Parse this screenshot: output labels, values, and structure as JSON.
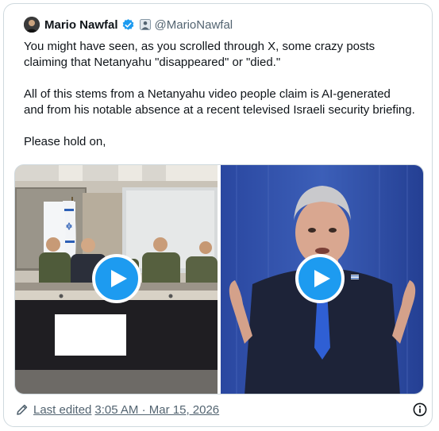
{
  "author": {
    "name": "Mario Nawfal",
    "handle": "@MarioNawfal",
    "verified_color": "#1d9bf0"
  },
  "post": {
    "paragraphs": [
      [
        "You might have seen, as you scrolled through X, some crazy posts",
        "claiming that Netanyahu \"disappeared\" or \"died.\""
      ],
      [
        "All of this stems from a Netanyahu video people claim is AI-generated",
        "and from his notable absence at a recent televised Israeli security briefing."
      ],
      [
        "Please hold on,"
      ]
    ]
  },
  "media": {
    "videos": [
      {
        "icon": "play-icon"
      },
      {
        "icon": "play-icon"
      }
    ],
    "accent": "#1d9bf0"
  },
  "footer": {
    "edited_label": "Last edited",
    "timestamp": "3:05 AM · Mar 15, 2026",
    "edit_icon": "pencil-icon",
    "info_icon": "info-icon"
  }
}
